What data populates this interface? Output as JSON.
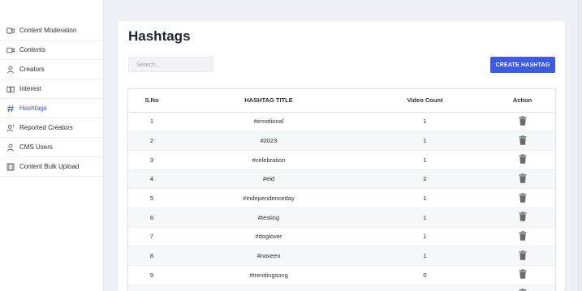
{
  "sidebar": {
    "items": [
      {
        "label": "Content Moderation",
        "icon": "video-icon"
      },
      {
        "label": "Contents",
        "icon": "video-camera-icon"
      },
      {
        "label": "Creators",
        "icon": "person-icon"
      },
      {
        "label": "Interest",
        "icon": "book-icon"
      },
      {
        "label": "Hashtags",
        "icon": "hashtag-icon",
        "active": true
      },
      {
        "label": "Reported Creators",
        "icon": "person-report-icon"
      },
      {
        "label": "CMS Users",
        "icon": "person-icon"
      },
      {
        "label": "Content Bulk Upload",
        "icon": "film-icon"
      }
    ]
  },
  "page": {
    "title": "Hashtags",
    "search_placeholder": "Search...",
    "create_button": "CREATE HASHTAG"
  },
  "table": {
    "headers": [
      "S.No",
      "HASHTAG TITLE",
      "Video Count",
      "Action"
    ],
    "rows": [
      {
        "sno": "1",
        "title": "#emotional",
        "count": "1"
      },
      {
        "sno": "2",
        "title": "#2023",
        "count": "1"
      },
      {
        "sno": "3",
        "title": "#celebration",
        "count": "1"
      },
      {
        "sno": "4",
        "title": "#eid",
        "count": "2"
      },
      {
        "sno": "5",
        "title": "#independenceday",
        "count": "1"
      },
      {
        "sno": "6",
        "title": "#testing",
        "count": "1"
      },
      {
        "sno": "7",
        "title": "#doglover",
        "count": "1"
      },
      {
        "sno": "8",
        "title": "#naveen",
        "count": "1"
      },
      {
        "sno": "9",
        "title": "#trendingsong",
        "count": "0"
      },
      {
        "sno": "",
        "title": "",
        "count": ""
      }
    ]
  },
  "colors": {
    "accent": "#3d5be0",
    "active_nav": "#3a53d6",
    "background": "#eef0f5",
    "trash": "#6b6b6b"
  }
}
